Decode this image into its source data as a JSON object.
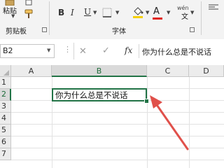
{
  "ribbon": {
    "clipboard": {
      "paste_label": "粘贴",
      "group_label": "剪贴板"
    },
    "font": {
      "bold_label": "B",
      "italic_label": "I",
      "underline_label": "U",
      "font_color_label": "A",
      "font_color": "#e0261d",
      "phonetic_top": "wén",
      "phonetic_char": "文",
      "group_label": "字体"
    }
  },
  "formula_bar": {
    "name_box": "B2",
    "formula_value": "你为什么总是不说话",
    "fx_label": "fx"
  },
  "grid": {
    "columns": [
      "A",
      "B",
      "C",
      "D"
    ],
    "rows": [
      "1",
      "2",
      "3",
      "4",
      "5",
      "6",
      "7"
    ],
    "selected_cell": {
      "ref": "B2",
      "value": "你为什么总是不说话"
    },
    "accent_color": "#217346"
  },
  "annotation": {
    "arrow_color": "#e0504a"
  }
}
